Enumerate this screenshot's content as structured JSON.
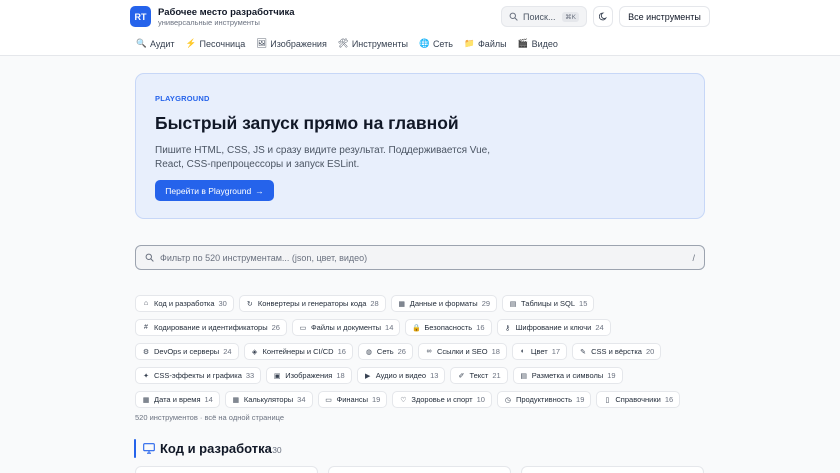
{
  "header": {
    "logo_text": "RT",
    "title": "Рабочее место разработчика",
    "subtitle": "универсальные инструменты",
    "search_label": "Поиск...",
    "search_shortcut": "⌘K",
    "all_tools_label": "Все инструменты"
  },
  "nav": {
    "items": [
      {
        "label": "Аудит",
        "icon": "🔍"
      },
      {
        "label": "Песочница",
        "icon": "⚡"
      },
      {
        "label": "Изображения",
        "icon": "🖼"
      },
      {
        "label": "Инструменты",
        "icon": "🛠"
      },
      {
        "label": "Сеть",
        "icon": "🌐"
      },
      {
        "label": "Файлы",
        "icon": "📁"
      },
      {
        "label": "Видео",
        "icon": "🎬"
      }
    ]
  },
  "hero": {
    "tag": "PLAYGROUND",
    "title": "Быстрый запуск прямо на главной",
    "description": "Пишите HTML, CSS, JS и сразу видите результат. Поддерживается Vue, React, CSS-препроцессоры и запуск ESLint.",
    "button_label": "Перейти в Playground",
    "button_arrow": "→"
  },
  "filter": {
    "placeholder": "Фильтр по 520 инструментам... (json, цвет, видео)",
    "shortcut": "/"
  },
  "categories": [
    {
      "label": "Код и разработка",
      "count": "30",
      "icon": "code-icon"
    },
    {
      "label": "Конвертеры и генераторы кода",
      "count": "28",
      "icon": "refresh-icon"
    },
    {
      "label": "Данные и форматы",
      "count": "29",
      "icon": "data-icon"
    },
    {
      "label": "Таблицы и SQL",
      "count": "15",
      "icon": "doc-icon"
    },
    {
      "label": "Кодирование и идентификаторы",
      "count": "26",
      "icon": "hash-icon"
    },
    {
      "label": "Файлы и документы",
      "count": "14",
      "icon": "folder-icon"
    },
    {
      "label": "Безопасность",
      "count": "16",
      "icon": "lock-icon"
    },
    {
      "label": "Шифрование и ключи",
      "count": "24",
      "icon": "key-icon"
    },
    {
      "label": "DevOps и серверы",
      "count": "24",
      "icon": "gear-icon"
    },
    {
      "label": "Контейнеры и CI/CD",
      "count": "16",
      "icon": "box-icon"
    },
    {
      "label": "Сеть",
      "count": "26",
      "icon": "globe-icon"
    },
    {
      "label": "Ссылки и SEO",
      "count": "18",
      "icon": "link-icon"
    },
    {
      "label": "Цвет",
      "count": "17",
      "icon": "palette-icon"
    },
    {
      "label": "CSS и вёрстка",
      "count": "20",
      "icon": "brush-icon"
    },
    {
      "label": "CSS-эффекты и графика",
      "count": "33",
      "icon": "sparkle-icon"
    },
    {
      "label": "Изображения",
      "count": "18",
      "icon": "image-icon"
    },
    {
      "label": "Аудио и видео",
      "count": "13",
      "icon": "video-icon"
    },
    {
      "label": "Текст",
      "count": "21",
      "icon": "pen-icon"
    },
    {
      "label": "Разметка и символы",
      "count": "19",
      "icon": "doc-icon"
    },
    {
      "label": "Дата и время",
      "count": "14",
      "icon": "calendar-icon"
    },
    {
      "label": "Калькуляторы",
      "count": "34",
      "icon": "calculator-icon"
    },
    {
      "label": "Финансы",
      "count": "19",
      "icon": "wallet-icon"
    },
    {
      "label": "Здоровье и спорт",
      "count": "10",
      "icon": "heart-icon"
    },
    {
      "label": "Продуктивность",
      "count": "19",
      "icon": "clock-icon"
    },
    {
      "label": "Справочники",
      "count": "16",
      "icon": "book-icon"
    }
  ],
  "summary": "520 инструментов · всё на одной странице",
  "section": {
    "title": "Код и разработка",
    "count": "· 30"
  },
  "colors": {
    "accent": "#2563eb",
    "hero_bg": "#e8effc"
  }
}
